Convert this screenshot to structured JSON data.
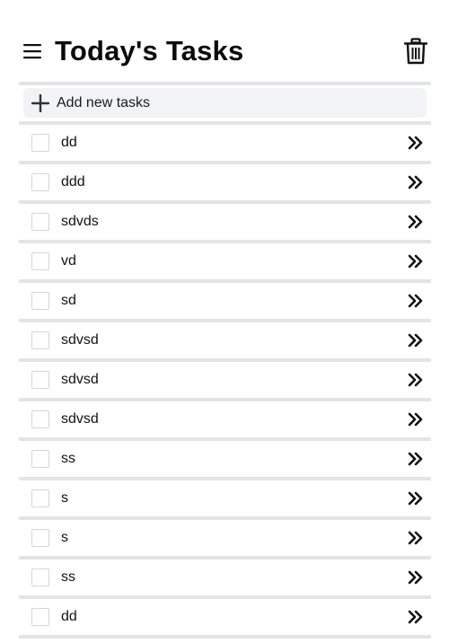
{
  "header": {
    "title": "Today's Tasks",
    "menu_icon": "hamburger-menu-icon",
    "delete_icon": "trash-icon"
  },
  "add_task": {
    "icon": "plus-icon",
    "label": "Add new tasks"
  },
  "tasks": [
    {
      "text": "dd",
      "checked": false
    },
    {
      "text": "ddd",
      "checked": false
    },
    {
      "text": "sdvds",
      "checked": false
    },
    {
      "text": "vd",
      "checked": false
    },
    {
      "text": "sd",
      "checked": false
    },
    {
      "text": "sdvsd",
      "checked": false
    },
    {
      "text": "sdvsd",
      "checked": false
    },
    {
      "text": "sdvsd",
      "checked": false
    },
    {
      "text": "ss",
      "checked": false
    },
    {
      "text": "s",
      "checked": false
    },
    {
      "text": "s",
      "checked": false
    },
    {
      "text": "ss",
      "checked": false
    },
    {
      "text": "dd",
      "checked": false
    }
  ],
  "task_action_icon": "double-chevron-right-icon",
  "colors": {
    "divider": "#e4e4e4",
    "add_row_bg": "#f2f3f5",
    "checkbox_border": "#d6d6d6",
    "text": "#111111"
  }
}
